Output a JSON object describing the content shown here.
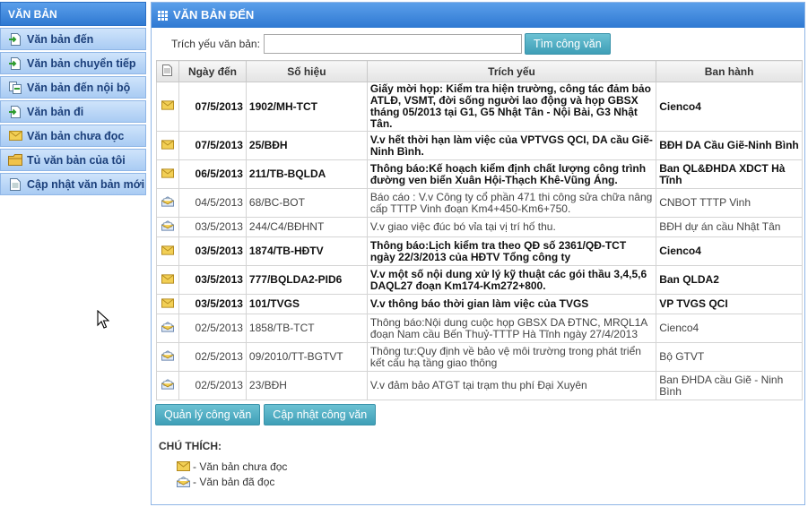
{
  "sidebar": {
    "title": "VĂN BẢN",
    "items": [
      {
        "label": "Văn bản đến",
        "icon": "document-arrow-icon"
      },
      {
        "label": "Văn bản chuyển tiếp",
        "icon": "document-arrow-icon"
      },
      {
        "label": "Văn bản đến nội bộ",
        "icon": "document-copy-icon"
      },
      {
        "label": "Văn bản đi",
        "icon": "document-arrow-icon"
      },
      {
        "label": "Văn bản chưa đọc",
        "icon": "envelope-icon"
      },
      {
        "label": "Tủ văn bản của tôi",
        "icon": "folder-icon"
      },
      {
        "label": "Cập nhật văn bản mới",
        "icon": "document-icon"
      }
    ]
  },
  "panel": {
    "title": "VĂN BẢN ĐẾN",
    "search_label": "Trích yếu văn bản:",
    "search_value": "",
    "search_button": "Tìm công văn"
  },
  "table": {
    "headers": [
      "Ngày đến",
      "Số hiệu",
      "Trích yếu",
      "Ban hành"
    ],
    "rows": [
      {
        "status": "unread",
        "date": "07/5/2013",
        "number": "1902/MH-TCT",
        "summary": "Giấy mời họp: Kiểm tra hiện trường, công tác đảm bảo ATLĐ, VSMT, đời sống người lao động và họp GBSX tháng 05/2013 tại G1, G5 Nhật Tân - Nội Bài, G3 Nhật Tân.",
        "issuer": "Cienco4"
      },
      {
        "status": "unread",
        "date": "07/5/2013",
        "number": "25/BĐH",
        "summary": "V.v hết thời hạn làm việc của VPTVGS QCI, DA cầu Giẽ-Ninh Bình.",
        "issuer": "BĐH DA Cầu Giẽ-Ninh Bình"
      },
      {
        "status": "unread",
        "date": "06/5/2013",
        "number": "211/TB-BQLDA",
        "summary": "Thông báo:Kế hoạch kiểm định chất lượng công trình đường ven biển Xuân Hội-Thạch Khê-Vũng Áng.",
        "issuer": "Ban QL&ĐHDA XDCT Hà Tĩnh"
      },
      {
        "status": "read",
        "date": "04/5/2013",
        "number": "68/BC-BOT",
        "summary": "Báo cáo : V.v Công ty cổ phần 471 thi công sửa chữa nâng cấp TTTP Vinh đoạn Km4+450-Km6+750.",
        "issuer": "CNBOT TTTP Vinh"
      },
      {
        "status": "read",
        "date": "03/5/2013",
        "number": "244/C4/BĐHNT",
        "summary": "V.v giao việc đúc bó vỉa tại vị trí hố thu.",
        "issuer": "BĐH dự án cầu Nhật Tân"
      },
      {
        "status": "unread",
        "date": "03/5/2013",
        "number": "1874/TB-HĐTV",
        "summary": "Thông báo:Lịch kiểm tra theo QĐ số 2361/QĐ-TCT ngày 22/3/2013 của HĐTV Tổng công ty",
        "issuer": "Cienco4"
      },
      {
        "status": "unread",
        "date": "03/5/2013",
        "number": "777/BQLDA2-PID6",
        "summary": "V.v một số nội dung xử lý kỹ thuật các gói thầu 3,4,5,6 DAQL27 đoạn Km174-Km272+800.",
        "issuer": "Ban QLDA2"
      },
      {
        "status": "unread",
        "date": "03/5/2013",
        "number": "101/TVGS",
        "summary": "V.v thông báo thời gian làm việc của TVGS",
        "issuer": "VP TVGS QCI"
      },
      {
        "status": "read",
        "date": "02/5/2013",
        "number": "1858/TB-TCT",
        "summary": "Thông báo:Nội dung cuộc họp GBSX DA ĐTNC, MRQL1A đoạn Nam cầu Bến Thuỷ-TTTP Hà Tĩnh ngày 27/4/2013",
        "issuer": "Cienco4"
      },
      {
        "status": "read",
        "date": "02/5/2013",
        "number": "09/2010/TT-BGTVT",
        "summary": "Thông tư:Quy định về bảo vệ môi trường trong phát triển kết cấu hạ tầng giao thông",
        "issuer": "Bộ GTVT"
      },
      {
        "status": "read",
        "date": "02/5/2013",
        "number": "23/BĐH",
        "summary": "V.v đảm bảo ATGT tại trạm thu phí Đại Xuyên",
        "issuer": "Ban ĐHDA cầu Giẽ - Ninh Bình"
      }
    ]
  },
  "buttons": {
    "manage": "Quản lý công văn",
    "update": "Cập nhật công văn"
  },
  "legend": {
    "title": "CHÚ THÍCH:",
    "unread": "- Văn bản chưa đọc",
    "read": "- Văn bản đã đọc"
  },
  "colors": {
    "header_blue": "#2f79d2",
    "sidebar_item": "#a9cbf3",
    "button_teal": "#3f9fb7",
    "envelope_unread": "#f2cf55",
    "envelope_read": "#9fb9d9"
  }
}
